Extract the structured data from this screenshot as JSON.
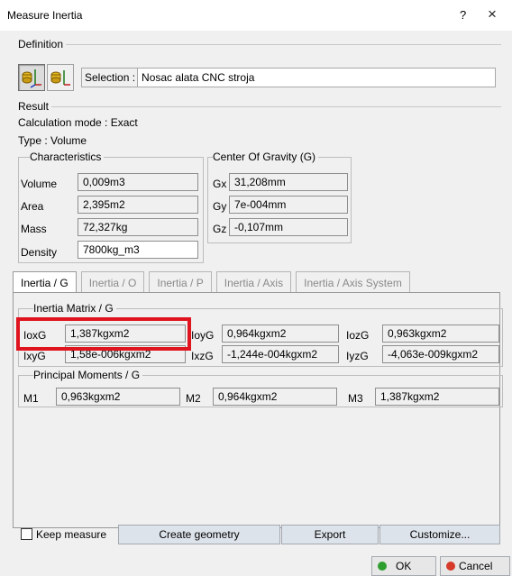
{
  "window": {
    "title": "Measure Inertia",
    "help_glyph": "?",
    "close_glyph": "×"
  },
  "definition": {
    "label": "Definition",
    "selection_label": "Selection :",
    "selection_value": "Nosac alata CNC stroja",
    "icon1": "measure-inertia-3d-icon",
    "icon2": "measure-inertia-2d-icon"
  },
  "result": {
    "label": "Result",
    "calc_mode": "Calculation mode : Exact",
    "type": "Type : Volume",
    "characteristics": {
      "label": "Characteristics",
      "rows": [
        {
          "label": "Volume",
          "value": "0,009m3"
        },
        {
          "label": "Area",
          "value": "2,395m2"
        },
        {
          "label": "Mass",
          "value": "72,327kg"
        },
        {
          "label": "Density",
          "value": "7800kg_m3"
        }
      ]
    },
    "cog": {
      "label": "Center Of Gravity (G)",
      "rows": [
        {
          "label": "Gx",
          "value": "31,208mm"
        },
        {
          "label": "Gy",
          "value": "7e-004mm"
        },
        {
          "label": "Gz",
          "value": "-0,107mm"
        }
      ]
    }
  },
  "tabs": [
    {
      "label": "Inertia / G",
      "active": true
    },
    {
      "label": "Inertia / O",
      "active": false
    },
    {
      "label": "Inertia / P",
      "active": false
    },
    {
      "label": "Inertia / Axis",
      "active": false
    },
    {
      "label": "Inertia / Axis System",
      "active": false
    }
  ],
  "inertia_matrix": {
    "label": "Inertia Matrix / G",
    "row1": [
      {
        "label": "IoxG",
        "value": "1,387kgxm2"
      },
      {
        "label": "IoyG",
        "value": "0,964kgxm2"
      },
      {
        "label": "IozG",
        "value": "0,963kgxm2"
      }
    ],
    "row2": [
      {
        "label": "IxyG",
        "value": "1,58e-006kgxm2"
      },
      {
        "label": "IxzG",
        "value": "-1,244e-004kgxm2"
      },
      {
        "label": "IyzG",
        "value": "-4,063e-009kgxm2"
      }
    ]
  },
  "principal_moments": {
    "label": "Principal Moments / G",
    "items": [
      {
        "label": "M1",
        "value": "0,963kgxm2"
      },
      {
        "label": "M2",
        "value": "0,964kgxm2"
      },
      {
        "label": "M3",
        "value": "1,387kgxm2"
      }
    ]
  },
  "footer": {
    "keep_measure": "Keep measure",
    "create_geometry": "Create geometry",
    "export": "Export",
    "customize": "Customize...",
    "ok": "OK",
    "cancel": "Cancel",
    "ok_color": "#2e9e2e",
    "cancel_color": "#d63a2a"
  },
  "highlight_color": "#e0141e"
}
